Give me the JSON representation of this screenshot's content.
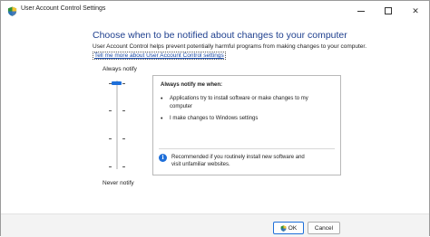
{
  "window": {
    "title": "User Account Control Settings",
    "icon": "uac-shield-icon",
    "controls": [
      "minimize-icon",
      "maximize-icon",
      "close-icon"
    ],
    "close_glyph": "✕"
  },
  "main": {
    "heading": "Choose when to be notified about changes to your computer",
    "description": "User Account Control helps prevent potentially harmful programs from making changes to your computer.",
    "help_link": "Tell me more about User Account Control settings"
  },
  "slider": {
    "top_label": "Always notify",
    "bottom_label": "Never notify",
    "levels": 4,
    "selected_level": 4,
    "selected_level_name": "Always notify"
  },
  "info_panel": {
    "title": "Always notify me when:",
    "items": [
      "Applications try to install software or make changes to my computer",
      "I make changes to Windows settings"
    ],
    "bullet": "•",
    "info_glyph": "i",
    "recommendation": "Recommended if you routinely install new software and visit unfamiliar websites."
  },
  "buttons": {
    "ok_label": "OK",
    "cancel_label": "Cancel"
  },
  "colors": {
    "heading": "#1e3f8e",
    "link": "#1a4aa8",
    "accent": "#1e6fd9"
  }
}
